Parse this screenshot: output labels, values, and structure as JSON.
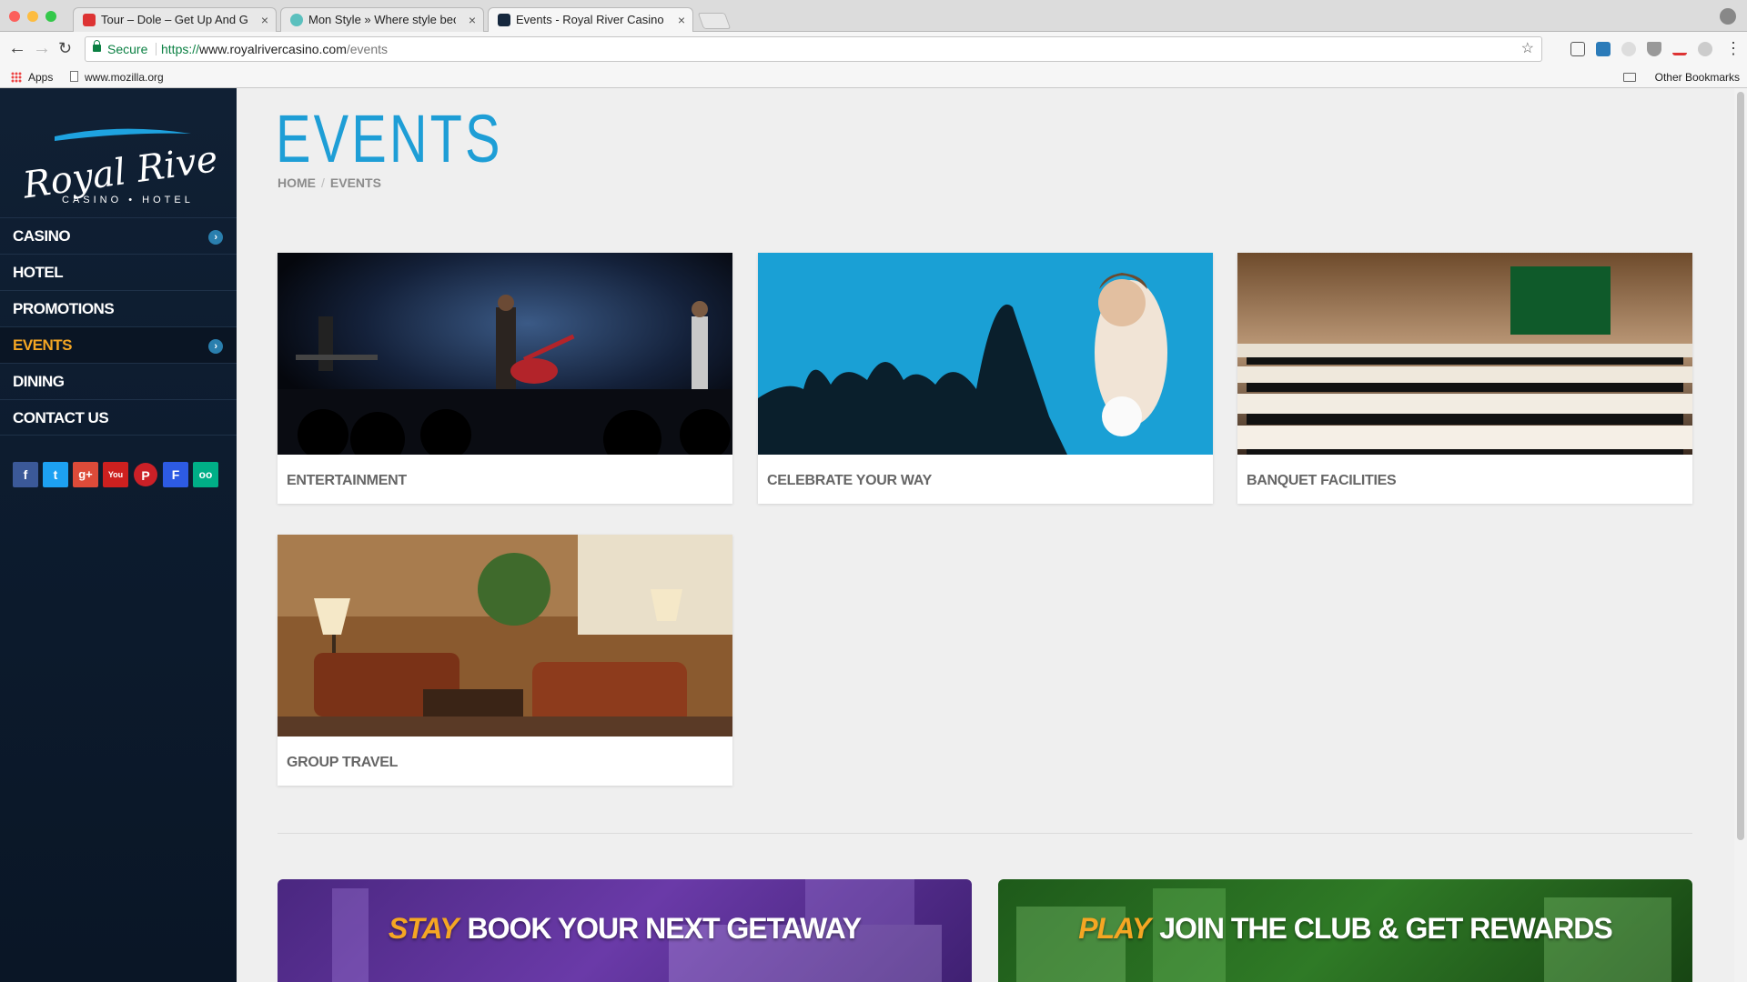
{
  "browser": {
    "tabs": [
      {
        "title": "Tour – Dole – Get Up And Grow"
      },
      {
        "title": "Mon Style » Where style beco"
      },
      {
        "title": "Events - Royal River Casino &"
      }
    ],
    "security_label": "Secure",
    "url": {
      "scheme": "https://",
      "host": "www.royalrivercasino.com",
      "path": "/events"
    },
    "bookmarks": {
      "apps": "Apps",
      "site": "www.mozilla.org",
      "other": "Other Bookmarks"
    }
  },
  "sidebar": {
    "logo": {
      "name": "Royal River",
      "tagline": "CASINO • HOTEL"
    },
    "menu": [
      {
        "label": "CASINO",
        "has_arrow": true
      },
      {
        "label": "HOTEL"
      },
      {
        "label": "PROMOTIONS"
      },
      {
        "label": "EVENTS",
        "has_arrow": true,
        "active": true
      },
      {
        "label": "DINING"
      },
      {
        "label": "CONTACT US"
      }
    ],
    "social": [
      {
        "icon": "facebook-icon",
        "glyph": "f",
        "color": "#3b5998"
      },
      {
        "icon": "twitter-icon",
        "glyph": "t",
        "color": "#1da1f2"
      },
      {
        "icon": "google-plus-icon",
        "glyph": "g+",
        "color": "#dd4b39"
      },
      {
        "icon": "youtube-icon",
        "glyph": "You",
        "color": "#cd201f"
      },
      {
        "icon": "pinterest-icon",
        "glyph": "P",
        "color": "#cb2027"
      },
      {
        "icon": "foursquare-icon",
        "glyph": "F",
        "color": "#2d5be3"
      },
      {
        "icon": "tripadvisor-icon",
        "glyph": "oo",
        "color": "#00af87"
      }
    ]
  },
  "main": {
    "title": "EVENTS",
    "breadcrumb": [
      "HOME",
      "EVENTS"
    ],
    "cards": [
      {
        "label": "ENTERTAINMENT"
      },
      {
        "label": "CELEBRATE YOUR WAY"
      },
      {
        "label": "BANQUET FACILITIES"
      },
      {
        "label": "GROUP TRAVEL"
      }
    ],
    "promos": [
      {
        "keyword": "STAY",
        "text": "BOOK YOUR NEXT GETAWAY"
      },
      {
        "keyword": "PLAY",
        "text": "JOIN THE CLUB & GET REWARDS"
      }
    ]
  },
  "colors": {
    "accent": "#1e9ed6",
    "active_menu": "#f5a623",
    "sidebar_bg": "#0d1c2f"
  }
}
